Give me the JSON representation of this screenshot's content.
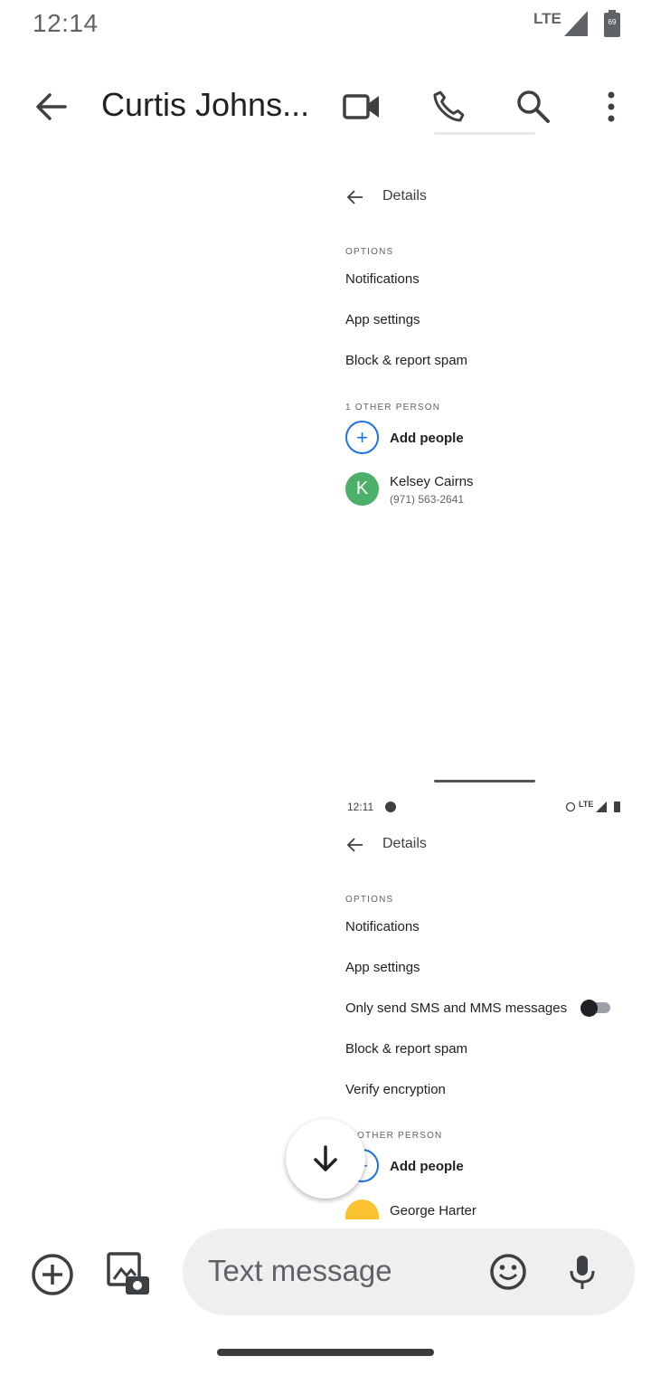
{
  "status_bar": {
    "time": "12:14",
    "network": "LTE",
    "battery": "69"
  },
  "app_bar": {
    "title": "Curtis Johns..."
  },
  "screenshot_1": {
    "header": "Details",
    "options_section": "OPTIONS",
    "options": [
      "Notifications",
      "App settings",
      "Block & report spam"
    ],
    "people_section": "1 OTHER PERSON",
    "add_people": "Add people",
    "contact": {
      "initial": "K",
      "name": "Kelsey Cairns",
      "phone": "(971) 563-2641",
      "color": "#4caf6a"
    }
  },
  "screenshot_2": {
    "time": "12:11",
    "network": "LTE",
    "header": "Details",
    "options_section": "OPTIONS",
    "options": [
      "Notifications",
      "App settings",
      "Only send SMS and MMS messages",
      "Block & report spam",
      "Verify encryption"
    ],
    "people_section": "OTHER PERSON",
    "add_people": "Add people",
    "contact_partial": "George Harter",
    "contact_color": "#f9c22e"
  },
  "compose": {
    "placeholder": "Text message"
  },
  "colors": {
    "accent": "#1a73e8"
  }
}
